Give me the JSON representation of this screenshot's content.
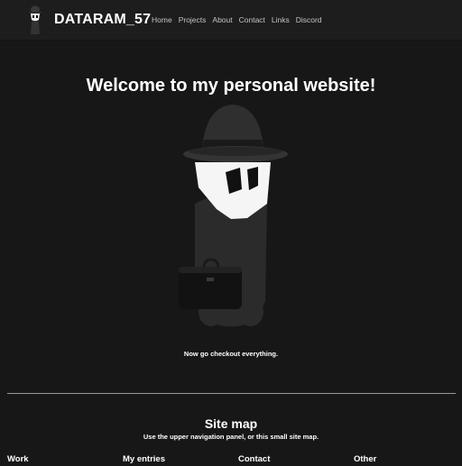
{
  "header": {
    "brand": "DATARAM_57",
    "nav": [
      "Home",
      "Projects",
      "About",
      "Contact",
      "Links",
      "Discord"
    ]
  },
  "hero": {
    "title": "Welcome to my personal website!",
    "caption": "Now go checkout everything."
  },
  "sitemap": {
    "title": "Site map",
    "subtitle": "Use the upper navigation panel, or this small site map.",
    "columns": [
      "Work",
      "My entries",
      "Contact",
      "Other"
    ]
  },
  "colors": {
    "background": "#171717",
    "navbar": "#1d1d1d",
    "text": "#ffffff",
    "nav_text": "#c3c3c3"
  }
}
